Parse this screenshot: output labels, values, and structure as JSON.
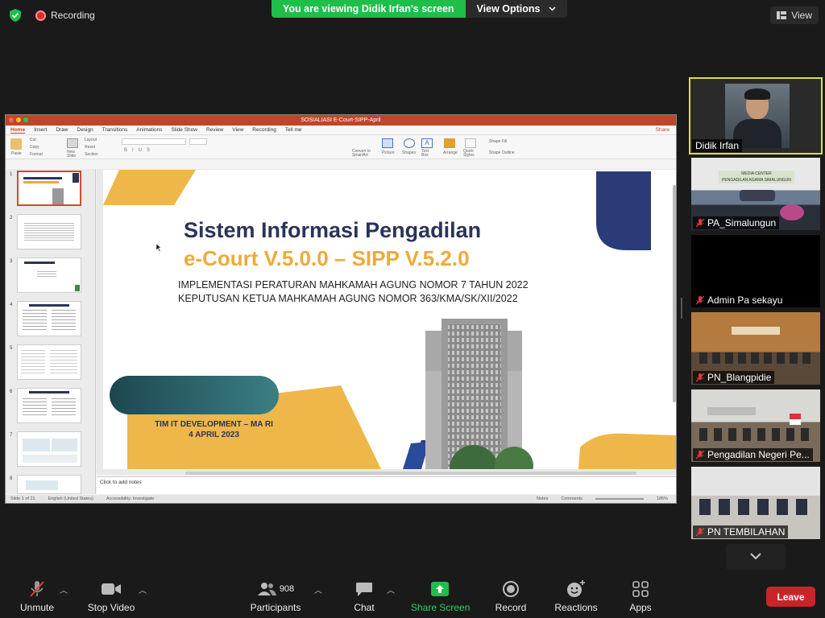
{
  "top": {
    "recording_label": "Recording",
    "share_banner": "You are viewing Didik Irfan's screen",
    "view_options": "View Options",
    "view_button": "View"
  },
  "ppt": {
    "window_title": "SOSIALIASI E-Court-SIPP-April",
    "tabs": [
      "Home",
      "Insert",
      "Draw",
      "Design",
      "Transitions",
      "Animations",
      "Slide Show",
      "Review",
      "View",
      "Recording",
      "Tell me"
    ],
    "share": "Share",
    "ribbon": {
      "paste": "Paste",
      "cut": "Cut",
      "copy": "Copy",
      "format": "Format",
      "new_slide": "New Slide",
      "layout": "Layout",
      "reset": "Reset",
      "section": "Section",
      "convert": "Convert to SmartArt",
      "picture": "Picture",
      "shapes": "Shapes",
      "textbox": "Text Box",
      "arrange": "Arrange",
      "quick_styles": "Quick Styles",
      "shape_fill": "Shape Fill",
      "shape_outline": "Shape Outline"
    },
    "slide_numbers": [
      "1",
      "2",
      "3",
      "4",
      "5",
      "6",
      "7",
      "8"
    ],
    "slide": {
      "title_line1": "Sistem Informasi Pengadilan",
      "title_line2": "e-Court V.5.0.0 – SIPP V.5.2.0",
      "subtitle_line1": "IMPLEMENTASI PERATURAN MAHKAMAH AGUNG NOMOR 7 TAHUN 2022",
      "subtitle_line2": "KEPUTUSAN KETUA MAHKAMAH AGUNG NOMOR 363/KMA/SK/XII/2022",
      "team_line1": "TIM IT DEVELOPMENT – MA RI",
      "team_line2": "4 APRIL 2023"
    },
    "notes_placeholder": "Click to add notes",
    "status": {
      "slide_of": "Slide 1 of 21",
      "language": "English (United States)",
      "accessibility": "Accessibility: Investigate",
      "notes": "Notes",
      "comments": "Comments",
      "zoom": "185%"
    }
  },
  "participants": [
    {
      "name": "Didik Irfan",
      "muted": false,
      "active": true
    },
    {
      "name": "PA_Simalungun",
      "muted": true,
      "active": false
    },
    {
      "name": "Admin Pa sekayu",
      "muted": true,
      "active": false
    },
    {
      "name": "PN_Blangpidie",
      "muted": true,
      "active": false
    },
    {
      "name": "Pengadilan Negeri Pe...",
      "muted": true,
      "active": false
    },
    {
      "name": "PN TEMBILAHAN",
      "muted": true,
      "active": false
    }
  ],
  "toolbar": {
    "unmute": "Unmute",
    "stop_video": "Stop Video",
    "participants": "Participants",
    "participants_count": "908",
    "chat": "Chat",
    "share_screen": "Share Screen",
    "record": "Record",
    "reactions": "Reactions",
    "apps": "Apps",
    "leave": "Leave"
  },
  "colors": {
    "share_green": "#1fbe4a",
    "leave_red": "#c8252a",
    "ppt_accent": "#c0442a",
    "slide_navy": "#2a3458",
    "slide_gold": "#efa93a"
  }
}
